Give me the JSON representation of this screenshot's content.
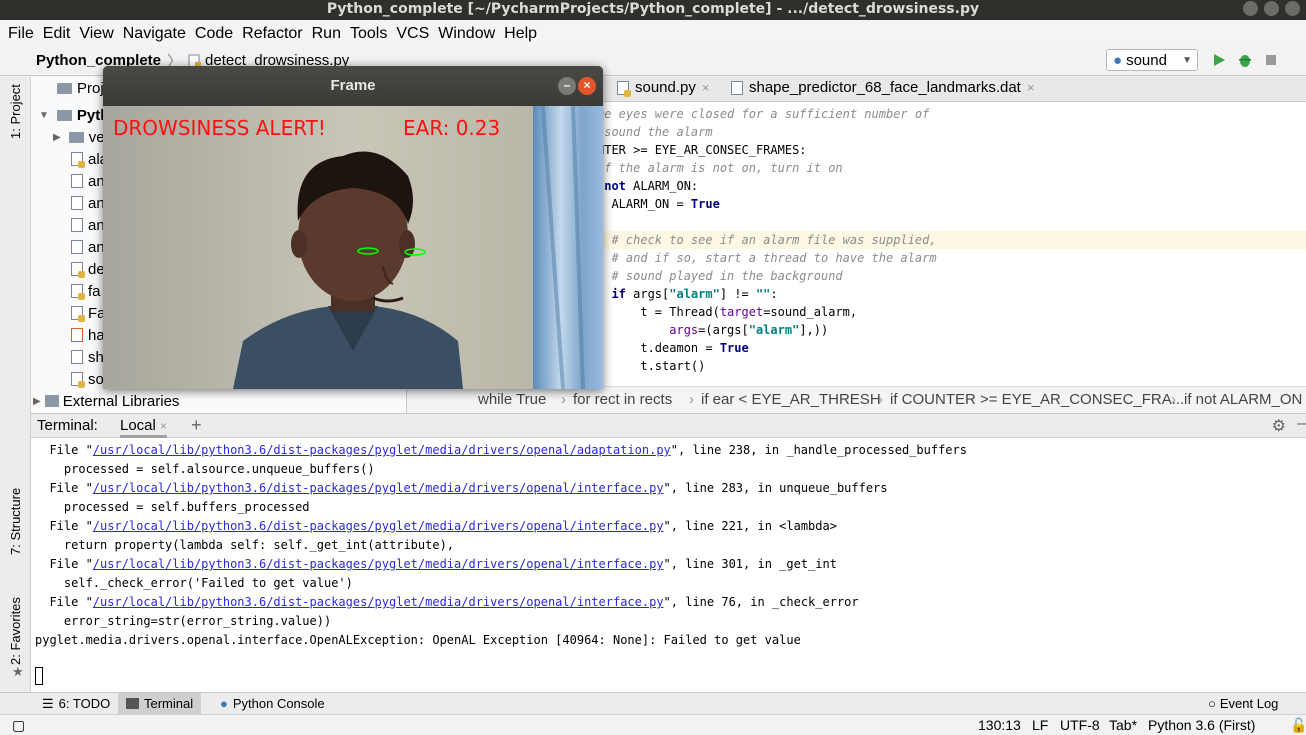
{
  "window": {
    "title": "Python_complete [~/PycharmProjects/Python_complete] - .../detect_drowsiness.py"
  },
  "menu": [
    "File",
    "Edit",
    "View",
    "Navigate",
    "Code",
    "Refactor",
    "Run",
    "Tools",
    "VCS",
    "Window",
    "Help"
  ],
  "nav": {
    "project": "Python_complete",
    "file": "detect_drowsiness.py",
    "run_config": "sound"
  },
  "side_tabs": {
    "project": "1: Project",
    "structure": "7: Structure",
    "favorites": "2: Favorites"
  },
  "project_panel": {
    "tab": "Project",
    "root": "Pyth",
    "items": [
      "ve",
      "ala",
      "an",
      "an",
      "an",
      "an",
      "de",
      "fa",
      "Fa",
      "ha",
      "sh",
      "so"
    ],
    "external": "External Libraries"
  },
  "editor_tabs": [
    {
      "label": "sound.py"
    },
    {
      "label": "shape_predictor_68_face_landmarks.dat"
    }
  ],
  "code_lines": [
    {
      "indent": "",
      "parts": [
        {
          "c": "cmt",
          "t": "he eyes were closed for a sufficient number of"
        }
      ]
    },
    {
      "indent": "",
      "parts": [
        {
          "c": "cmt",
          "t": " sound the alarm"
        }
      ]
    },
    {
      "indent": "",
      "parts": [
        {
          "c": "",
          "t": "NTER >= EYE_AR_CONSEC_FRAMES:"
        }
      ]
    },
    {
      "indent": "",
      "parts": [
        {
          "c": "cmt",
          "t": "if the alarm is not on, turn it on"
        }
      ]
    },
    {
      "indent": "",
      "parts": [
        {
          "c": "kw",
          "t": " not "
        },
        {
          "c": "",
          "t": "ALARM_ON:"
        }
      ]
    },
    {
      "indent": "",
      "parts": [
        {
          "c": "",
          "t": "  ALARM_ON = "
        },
        {
          "c": "kw",
          "t": "True"
        }
      ]
    },
    {
      "indent": "",
      "parts": [
        {
          "c": "",
          "t": ""
        }
      ]
    },
    {
      "indent": "",
      "parts": [
        {
          "c": "cmt",
          "t": "  # check to see if an alarm file was supplied,"
        }
      ]
    },
    {
      "indent": "",
      "parts": [
        {
          "c": "cmt",
          "t": "  # and if so, start a thread to have the alarm"
        }
      ]
    },
    {
      "indent": "",
      "parts": [
        {
          "c": "cmt",
          "t": "  # sound played in the background"
        }
      ]
    },
    {
      "indent": "",
      "parts": [
        {
          "c": "kw",
          "t": "  if "
        },
        {
          "c": "",
          "t": "args["
        },
        {
          "c": "str",
          "t": "\"alarm\""
        },
        {
          "c": "",
          "t": "] != "
        },
        {
          "c": "str",
          "t": "\"\""
        },
        {
          "c": "",
          "t": ":"
        }
      ]
    },
    {
      "indent": "",
      "parts": [
        {
          "c": "",
          "t": "      t = Thread("
        },
        {
          "c": "kwa",
          "t": "target"
        },
        {
          "c": "",
          "t": "=sound_alarm,"
        }
      ]
    },
    {
      "indent": "",
      "parts": [
        {
          "c": "",
          "t": "          "
        },
        {
          "c": "kwa",
          "t": "args"
        },
        {
          "c": "",
          "t": "=(args["
        },
        {
          "c": "str",
          "t": "\"alarm\""
        },
        {
          "c": "",
          "t": "],))"
        }
      ]
    },
    {
      "indent": "",
      "parts": [
        {
          "c": "",
          "t": "      t.deamon = "
        },
        {
          "c": "kw",
          "t": "True"
        }
      ]
    },
    {
      "indent": "",
      "parts": [
        {
          "c": "",
          "t": "      t.start()"
        }
      ]
    }
  ],
  "breadcrumb": [
    "while True",
    "for rect in rects",
    "if ear < EYE_AR_THRESH",
    "if COUNTER >= EYE_AR_CONSEC_FRA...",
    "if not ALARM_ON"
  ],
  "terminal": {
    "label": "Terminal:",
    "tab": "Local",
    "lines": [
      {
        "pre": "  File \"",
        "link": "/usr/local/lib/python3.6/dist-packages/pyglet/media/drivers/openal/adaptation.py",
        "post": "\", line 238, in _handle_processed_buffers"
      },
      {
        "pre": "    processed = self.alsource.unqueue_buffers()",
        "link": "",
        "post": ""
      },
      {
        "pre": "  File \"",
        "link": "/usr/local/lib/python3.6/dist-packages/pyglet/media/drivers/openal/interface.py",
        "post": "\", line 283, in unqueue_buffers"
      },
      {
        "pre": "    processed = self.buffers_processed",
        "link": "",
        "post": ""
      },
      {
        "pre": "  File \"",
        "link": "/usr/local/lib/python3.6/dist-packages/pyglet/media/drivers/openal/interface.py",
        "post": "\", line 221, in <lambda>"
      },
      {
        "pre": "    return property(lambda self: self._get_int(attribute),",
        "link": "",
        "post": ""
      },
      {
        "pre": "  File \"",
        "link": "/usr/local/lib/python3.6/dist-packages/pyglet/media/drivers/openal/interface.py",
        "post": "\", line 301, in _get_int"
      },
      {
        "pre": "    self._check_error('Failed to get value')",
        "link": "",
        "post": ""
      },
      {
        "pre": "  File \"",
        "link": "/usr/local/lib/python3.6/dist-packages/pyglet/media/drivers/openal/interface.py",
        "post": "\", line 76, in _check_error"
      },
      {
        "pre": "    error_string=str(error_string.value))",
        "link": "",
        "post": ""
      },
      {
        "pre": "pyglet.media.drivers.openal.interface.OpenALException: OpenAL Exception [40964: None]: Failed to get value",
        "link": "",
        "post": ""
      }
    ]
  },
  "bottom_tabs": {
    "todo": "6: TODO",
    "terminal": "Terminal",
    "console": "Python Console",
    "event_log": "Event Log"
  },
  "status": {
    "position": "130:13",
    "line_sep": "LF",
    "encoding": "UTF-8",
    "indent": "Tab*",
    "interpreter": "Python 3.6 (First)"
  },
  "frame_window": {
    "title": "Frame",
    "alert": "DROWSINESS ALERT!",
    "ear": "EAR: 0.23"
  },
  "colors": {
    "alert_red": "#ff1010",
    "eye_contour": "#00ff00",
    "title_bg": "#2f2f2b"
  }
}
